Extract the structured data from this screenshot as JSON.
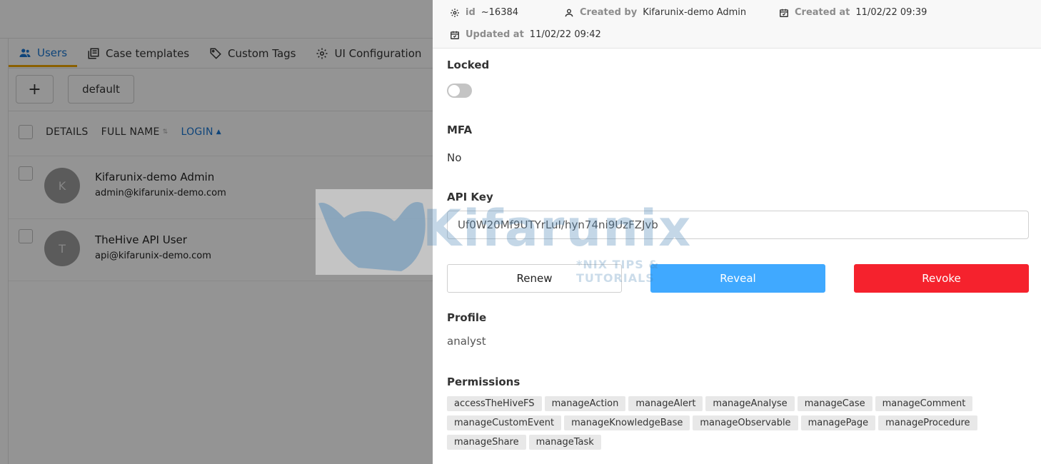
{
  "tabs": [
    {
      "label": "Users",
      "icon": "users-icon",
      "active": true
    },
    {
      "label": "Case templates",
      "icon": "template-icon",
      "active": false
    },
    {
      "label": "Custom Tags",
      "icon": "tag-icon",
      "active": false
    },
    {
      "label": "UI Configuration",
      "icon": "gear-icon",
      "active": false
    }
  ],
  "toolbar": {
    "add_label": "+",
    "default_label": "default"
  },
  "table": {
    "columns": [
      "DETAILS",
      "FULL NAME",
      "LOGIN"
    ],
    "rows": [
      {
        "initial": "K",
        "name": "Kifarunix-demo Admin",
        "login": "admin@kifarunix-demo.com"
      },
      {
        "initial": "T",
        "name": "TheHive API User",
        "login": "api@kifarunix-demo.com"
      }
    ]
  },
  "watermark": {
    "brand": "Kifarunix",
    "tagline": "*NIX TIPS & TUTORIALS"
  },
  "drawer": {
    "meta": {
      "id_label": "id",
      "id_value": "~16384",
      "created_by_label": "Created by",
      "created_by_value": "Kifarunix-demo Admin",
      "created_at_label": "Created at",
      "created_at_value": "11/02/22 09:39",
      "updated_at_label": "Updated at",
      "updated_at_value": "11/02/22 09:42"
    },
    "locked_label": "Locked",
    "locked_on": false,
    "mfa_label": "MFA",
    "mfa_value": "No",
    "api_key_label": "API Key",
    "api_key_value": "Uf0W20Mf9UTYrLuI/hyn74ni9UzFZJvb",
    "renew_label": "Renew",
    "reveal_label": "Reveal",
    "revoke_label": "Revoke",
    "profile_label": "Profile",
    "profile_value": "analyst",
    "permissions_label": "Permissions",
    "permissions": [
      "accessTheHiveFS",
      "manageAction",
      "manageAlert",
      "manageAnalyse",
      "manageCase",
      "manageComment",
      "manageCustomEvent",
      "manageKnowledgeBase",
      "manageObservable",
      "managePage",
      "manageProcedure",
      "manageShare",
      "manageTask"
    ]
  },
  "colors": {
    "primary": "#40a9ff",
    "danger": "#f5222d",
    "active_tab": "#1976d2",
    "tab_underline": "#f0a500"
  }
}
